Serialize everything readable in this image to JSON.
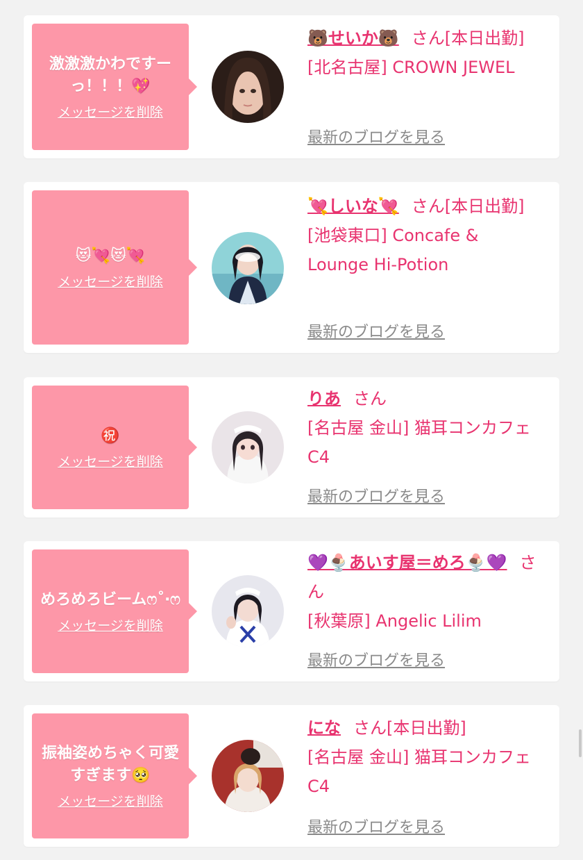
{
  "delete_label": "メッセージを削除",
  "blog_label": "最新のブログを見る",
  "san_label": "さん",
  "colors": {
    "bubble": "#fd97a8",
    "accent": "#e8336f",
    "link_gray": "#8a8a8a"
  },
  "cards": [
    {
      "message": "激激激かわですーっ！！！💖",
      "name": "🐻せいか🐻",
      "status": "[本日出勤]",
      "shop": "[北名古屋] CROWN JEWEL",
      "avatar": "avatar-seika"
    },
    {
      "message": "😻💘😻💘",
      "name": "💘しいな💘",
      "status": "[本日出勤]",
      "shop": "[池袋東口] Concafe & Lounge Hi-Potion",
      "avatar": "avatar-shiina"
    },
    {
      "message": "㊗️",
      "name": "りあ",
      "status": "",
      "shop": "[名古屋 金山] 猫耳コンカフェ C4",
      "avatar": "avatar-ria"
    },
    {
      "message": "めろめろビームෆ˚‧ෆ",
      "name": "💜🍨あいす屋＝めろ🍨💜",
      "status": "",
      "shop": "[秋葉原] Angelic Lilim",
      "avatar": "avatar-mero"
    },
    {
      "message": "振袖姿めちゃく可愛すぎます🥺",
      "name": "にな",
      "status": "[本日出勤]",
      "shop": "[名古屋 金山] 猫耳コンカフェ C4",
      "avatar": "avatar-nina"
    }
  ]
}
